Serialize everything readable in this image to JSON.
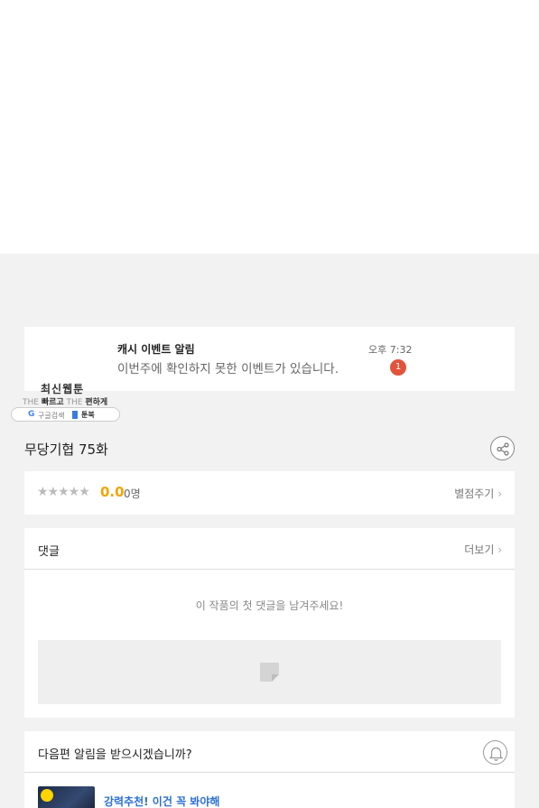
{
  "notification": {
    "title": "캐시 이벤트 알림",
    "body": "이번주에 확인하지 못한 이벤트가 있습니다.",
    "time": "오후 7:32",
    "badge_count": "1"
  },
  "logo": {
    "title": "최신웹툰",
    "sub_the1": "THE",
    "sub_word1": "빠르고",
    "sub_the2": "THE",
    "sub_word2": "편하게",
    "pill_g": "G",
    "pill_google": "구글검색",
    "pill_toonbook": "툰북"
  },
  "episode": {
    "title": "무당기협 75화"
  },
  "rating": {
    "stars": "★★★★★",
    "score": "0.0",
    "count": "0명",
    "rate_label": "별점주기"
  },
  "comments": {
    "title": "댓글",
    "more_label": "더보기",
    "empty_message": "이 작품의 첫 댓글을 남겨주세요!"
  },
  "next_alert": {
    "question": "다음편 알림을 받으시겠습니까?",
    "promo_text": "강력추천! 이건 꼭 봐야해"
  },
  "icons": {
    "share": "share-icon",
    "bell": "bell-icon",
    "chevron": "chevron-right-icon",
    "comment_input": "write-icon",
    "clock": "clock-icon"
  },
  "colors": {
    "accent_score": "#f0a500",
    "badge": "#e2533b",
    "promo_link": "#2b6fd6",
    "clock_badge": "#ffd400"
  }
}
